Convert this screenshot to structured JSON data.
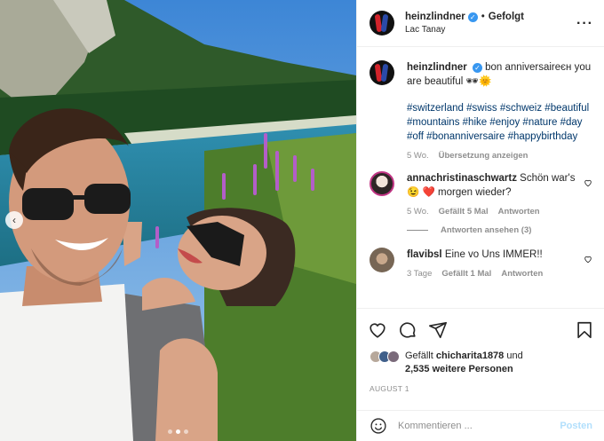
{
  "header": {
    "username": "heinzlindner",
    "separator": "•",
    "follow_status": "Gefolgt",
    "location": "Lac Tanay",
    "more_icon": "more-horizontal-icon"
  },
  "photo": {
    "description_icon": "photo",
    "carousel": {
      "total": 3,
      "active": 2
    }
  },
  "caption": {
    "username": "heinzlindner",
    "text": " bon anniversaireєн you are beautiful 🕶🌞",
    "hashtags": "#switzerland #swiss #schweiz #beautiful #mountains #hike #enjoy #nature #day #off #bonanniversaire #happybirthday",
    "age": "5 Wo.",
    "translate_label": "Übersetzung anzeigen"
  },
  "comments": [
    {
      "username": "annachristinaschwartz",
      "text": " Schön war's 😉 ❤️ morgen wieder?",
      "age": "5 Wo.",
      "likes": "Gefällt 5 Mal",
      "reply_label": "Antworten",
      "view_replies": "Antworten ansehen (3)"
    },
    {
      "username": "flavibsl",
      "text": " Eine vo Uns IMMER!!",
      "age": "3 Tage",
      "likes": "Gefällt 1 Mal",
      "reply_label": "Antworten"
    }
  ],
  "likes": {
    "prefix": "Gefällt ",
    "user": "chicharita1878",
    "joiner": " und",
    "others": "2,535 weitere Personen"
  },
  "date": "AUGUST 1",
  "composer": {
    "placeholder": "Kommentieren ...",
    "post_label": "Posten"
  },
  "colors": {
    "link": "#00376b",
    "verified": "#3897f0",
    "post_disabled": "#b2dffc",
    "muted": "#8e8e8e"
  }
}
